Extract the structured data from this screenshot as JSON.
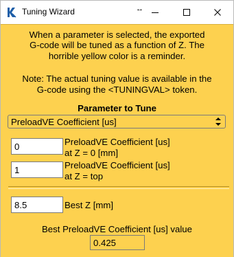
{
  "window": {
    "title": "Tuning Wizard",
    "icons": {
      "app": "app-logo-icon",
      "resize": "resize-arrows-icon",
      "minimize": "minimize-icon",
      "maximize": "maximize-icon",
      "close": "close-icon"
    },
    "background_color": "#fdd14f"
  },
  "notes": {
    "line1": "When a parameter is selected, the exported",
    "line2": "G-code will be tuned as a function of Z.  The",
    "line3": "horrible yellow color is a reminder.",
    "line4": "Note: The actual tuning value is available in the",
    "line5": "G-code using the <TUNINGVAL> token."
  },
  "parameter": {
    "section_title": "Parameter to Tune",
    "selected": "PreloadVE Coefficient [us]"
  },
  "fields": {
    "z0_value": "0",
    "z0_label_line1": "PreloadVE Coefficient [us]",
    "z0_label_line2": "at Z = 0 [mm]",
    "ztop_value": "1",
    "ztop_label_line1": "PreloadVE Coefficient [us]",
    "ztop_label_line2": "at Z = top",
    "bestz_value": "8.5",
    "bestz_label": "Best Z [mm]"
  },
  "result": {
    "label": "Best PreloadVE Coefficient [us] value",
    "value": "0.425"
  }
}
